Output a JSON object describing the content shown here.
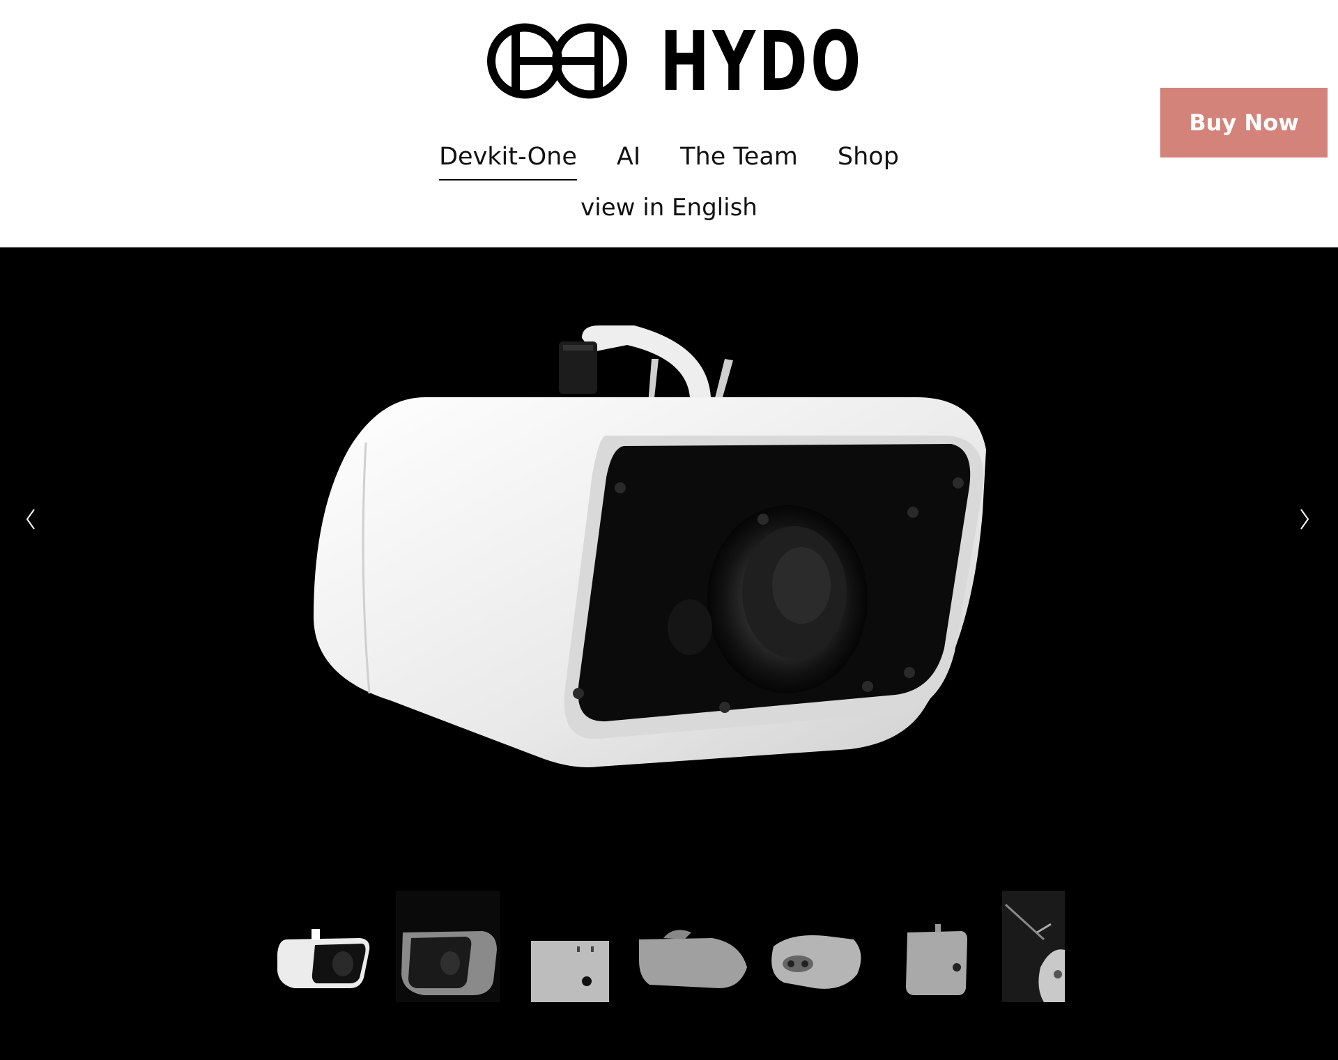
{
  "brand": {
    "name": "HYDO",
    "logo_icon": "hydo-logo-icon"
  },
  "nav": {
    "items": [
      {
        "label": "Devkit-One",
        "active": true
      },
      {
        "label": "AI",
        "active": false
      },
      {
        "label": "The Team",
        "active": false
      },
      {
        "label": "Shop",
        "active": false
      }
    ],
    "language_link": "view in English"
  },
  "buy_button": {
    "label": "Buy Now",
    "color": "#d4837a"
  },
  "carousel": {
    "prev_icon": "chevron-left-icon",
    "next_icon": "chevron-right-icon",
    "thumbnail_count": 7,
    "active_thumbnail": 1
  }
}
